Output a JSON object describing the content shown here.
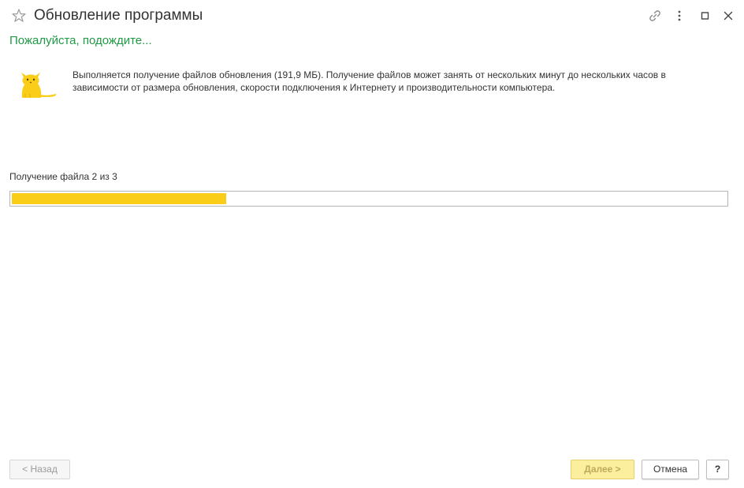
{
  "window": {
    "title": "Обновление программы",
    "subtitle": "Пожалуйста, подождите...",
    "icons": {
      "favorite": "star-outline-icon",
      "link": "link-icon",
      "more": "more-vertical-icon",
      "maximize": "maximize-icon",
      "close": "close-icon",
      "illustration": "cat-icon"
    }
  },
  "message": "Выполняется получение файлов обновления (191,9 МБ). Получение файлов может занять от нескольких минут до нескольких часов в зависимости от размера обновления, скорости подключения к Интернету и производительности компьютера.",
  "progress": {
    "label": "Получение файла 2 из 3",
    "percent": 30
  },
  "footer": {
    "back_label": "< Назад",
    "next_label": "Далее >",
    "cancel_label": "Отмена",
    "help_label": "?"
  },
  "colors": {
    "accent_green": "#1f9a45",
    "progress_yellow": "#f9cd18",
    "next_button_bg": "#fbee9d"
  }
}
